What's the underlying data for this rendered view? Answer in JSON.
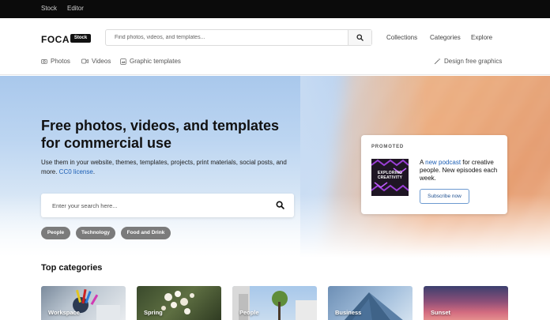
{
  "topbar": {
    "links": [
      "Stock",
      "Editor"
    ]
  },
  "header": {
    "logo": "FOCA",
    "logo_badge": "Stock",
    "search_placeholder": "Find photos, videos, and templates...",
    "nav": [
      "Collections",
      "Categories",
      "Explore"
    ]
  },
  "subnav": {
    "photos": "Photos",
    "videos": "Videos",
    "templates": "Graphic templates",
    "design": "Design free graphics"
  },
  "hero": {
    "title": "Free photos, videos, and templates for commercial use",
    "subtitle_pre": "Use them in your website, themes, templates, projects, print materials, social posts, and more. ",
    "subtitle_link": "CC0 license",
    "subtitle_post": ".",
    "search_placeholder": "Enter your search here...",
    "chips": [
      "People",
      "Technology",
      "Food and Drink"
    ]
  },
  "promo": {
    "label": "PROMOTED",
    "thumb_line1": "EXPLORING",
    "thumb_line2": "CREATIVITY",
    "text_pre": "A ",
    "text_link": "new podcast",
    "text_post": " for creative people. New episodes each week.",
    "button": "Subscribe now"
  },
  "categories": {
    "title": "Top categories",
    "items": [
      "Workspace",
      "Spring",
      "People",
      "Business",
      "Sunset"
    ]
  },
  "colors": {
    "accent_link": "#1d5fb5",
    "chip_bg": "#7b7b7b",
    "topbar_bg": "#0b0b0b"
  }
}
